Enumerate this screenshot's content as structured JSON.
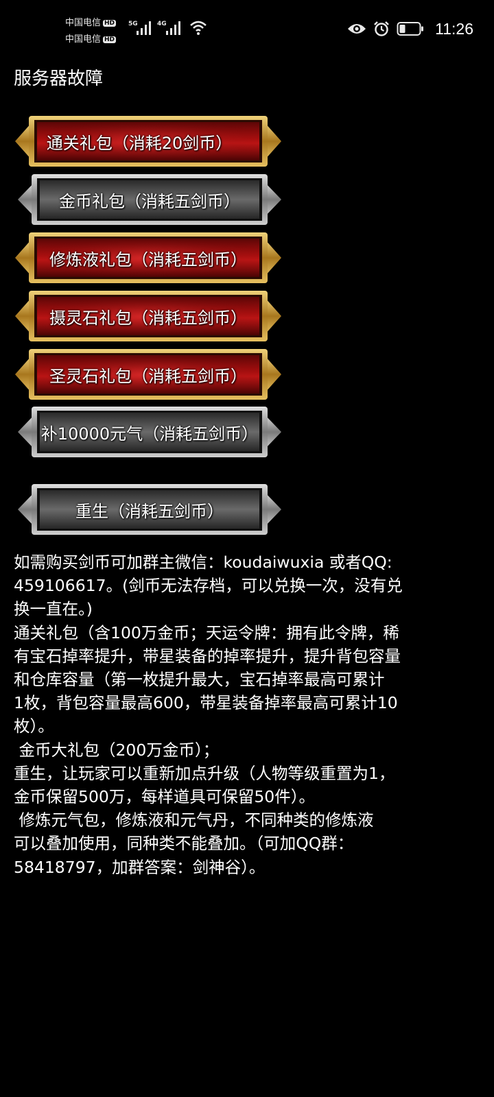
{
  "status_bar": {
    "carrier1": "中国电信",
    "carrier2": "中国电信",
    "hd_badge": "HD",
    "net1": "5G",
    "net2": "4G",
    "time": "11:26",
    "icons": [
      "eye-icon",
      "alarm-icon",
      "battery-icon",
      "wifi-icon",
      "signal-icon"
    ]
  },
  "page": {
    "title": "服务器故障"
  },
  "buttons": [
    {
      "label": "通关礼包（消耗20剑币）",
      "style": "red"
    },
    {
      "label": "金币礼包（消耗五剑币）",
      "style": "gray"
    },
    {
      "label": "修炼液礼包（消耗五剑币）",
      "style": "red"
    },
    {
      "label": "摄灵石礼包（消耗五剑币）",
      "style": "red"
    },
    {
      "label": "圣灵石礼包（消耗五剑币）",
      "style": "red"
    },
    {
      "label": "补10000元气（消耗五剑币）",
      "style": "gray"
    },
    {
      "label": "重生（消耗五剑币）",
      "style": "gray"
    }
  ],
  "info_lines": [
    "如需购买剑币可加群主微信：koudaiwuxia 或者QQ:",
    "459106617。(剑币无法存档，可以兑换一次，没有兑",
    "换一直在。)",
    "通关礼包（含100万金币；天运令牌：拥有此令牌，稀",
    "有宝石掉率提升，带星装备的掉率提升，提升背包容量",
    "和仓库容量（第一枚提升最大，宝石掉率最高可累计",
    "1枚，背包容量最高600，带星装备掉率最高可累计10",
    "枚）。",
    " 金币大礼包（200万金币）；",
    "重生，让玩家可以重新加点升级（人物等级重置为1，",
    "金币保留500万，每样道具可保留50件）。",
    " 修炼元气包，修炼液和元气丹，不同种类的修炼液",
    "可以叠加使用，同种类不能叠加。（可加QQ群：",
    "58418797，加群答案：剑神谷）。"
  ],
  "colors": {
    "background": "#000000",
    "red_face": "#b01010",
    "gold_frame": "#c9a23a",
    "gray_face": "#5a5a5a",
    "silver_frame": "#b8b8b8"
  }
}
